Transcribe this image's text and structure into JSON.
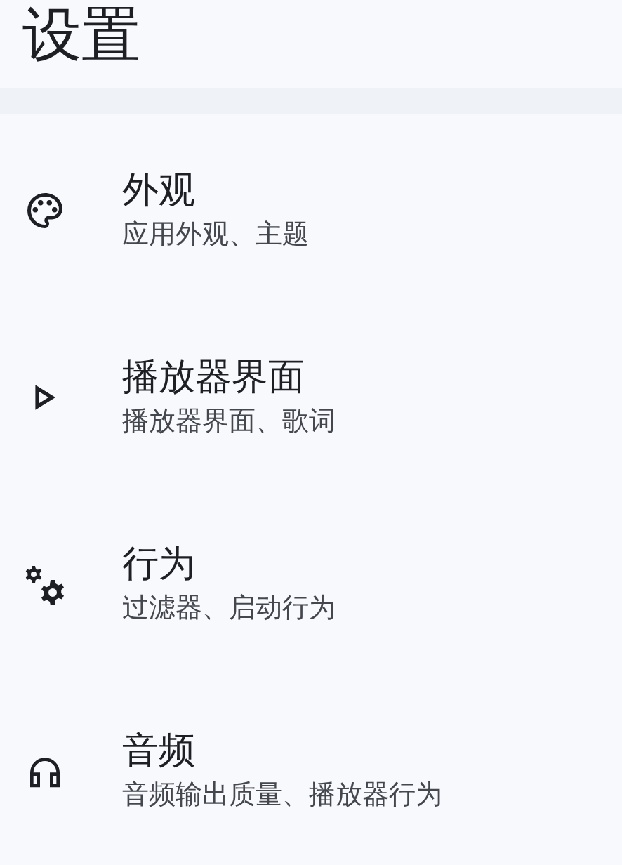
{
  "title": "设置",
  "items": [
    {
      "title": "外观",
      "subtitle": "应用外观、主题"
    },
    {
      "title": "播放器界面",
      "subtitle": "播放器界面、歌词"
    },
    {
      "title": "行为",
      "subtitle": "过滤器、启动行为"
    },
    {
      "title": "音频",
      "subtitle": "音频输出质量、播放器行为"
    }
  ]
}
